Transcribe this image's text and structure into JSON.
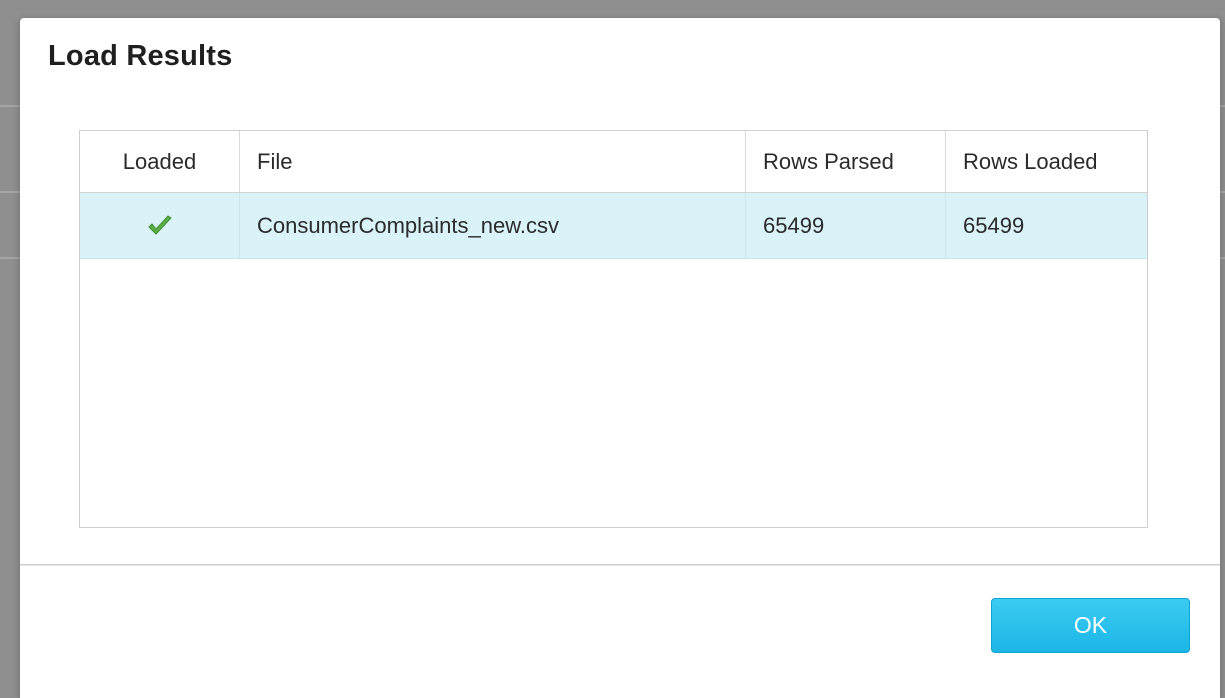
{
  "dialog": {
    "title": "Load Results",
    "ok_label": "OK"
  },
  "table": {
    "columns": {
      "loaded": "Loaded",
      "file": "File",
      "rows_parsed": "Rows Parsed",
      "rows_loaded": "Rows Loaded"
    },
    "rows": [
      {
        "loaded_icon": "check-icon",
        "file": "ConsumerComplaints_new.csv",
        "rows_parsed": "65499",
        "rows_loaded": "65499"
      }
    ]
  },
  "colors": {
    "selected_row": "#daf3f8",
    "button": "#1cb6e6",
    "check": "#5aae46"
  }
}
